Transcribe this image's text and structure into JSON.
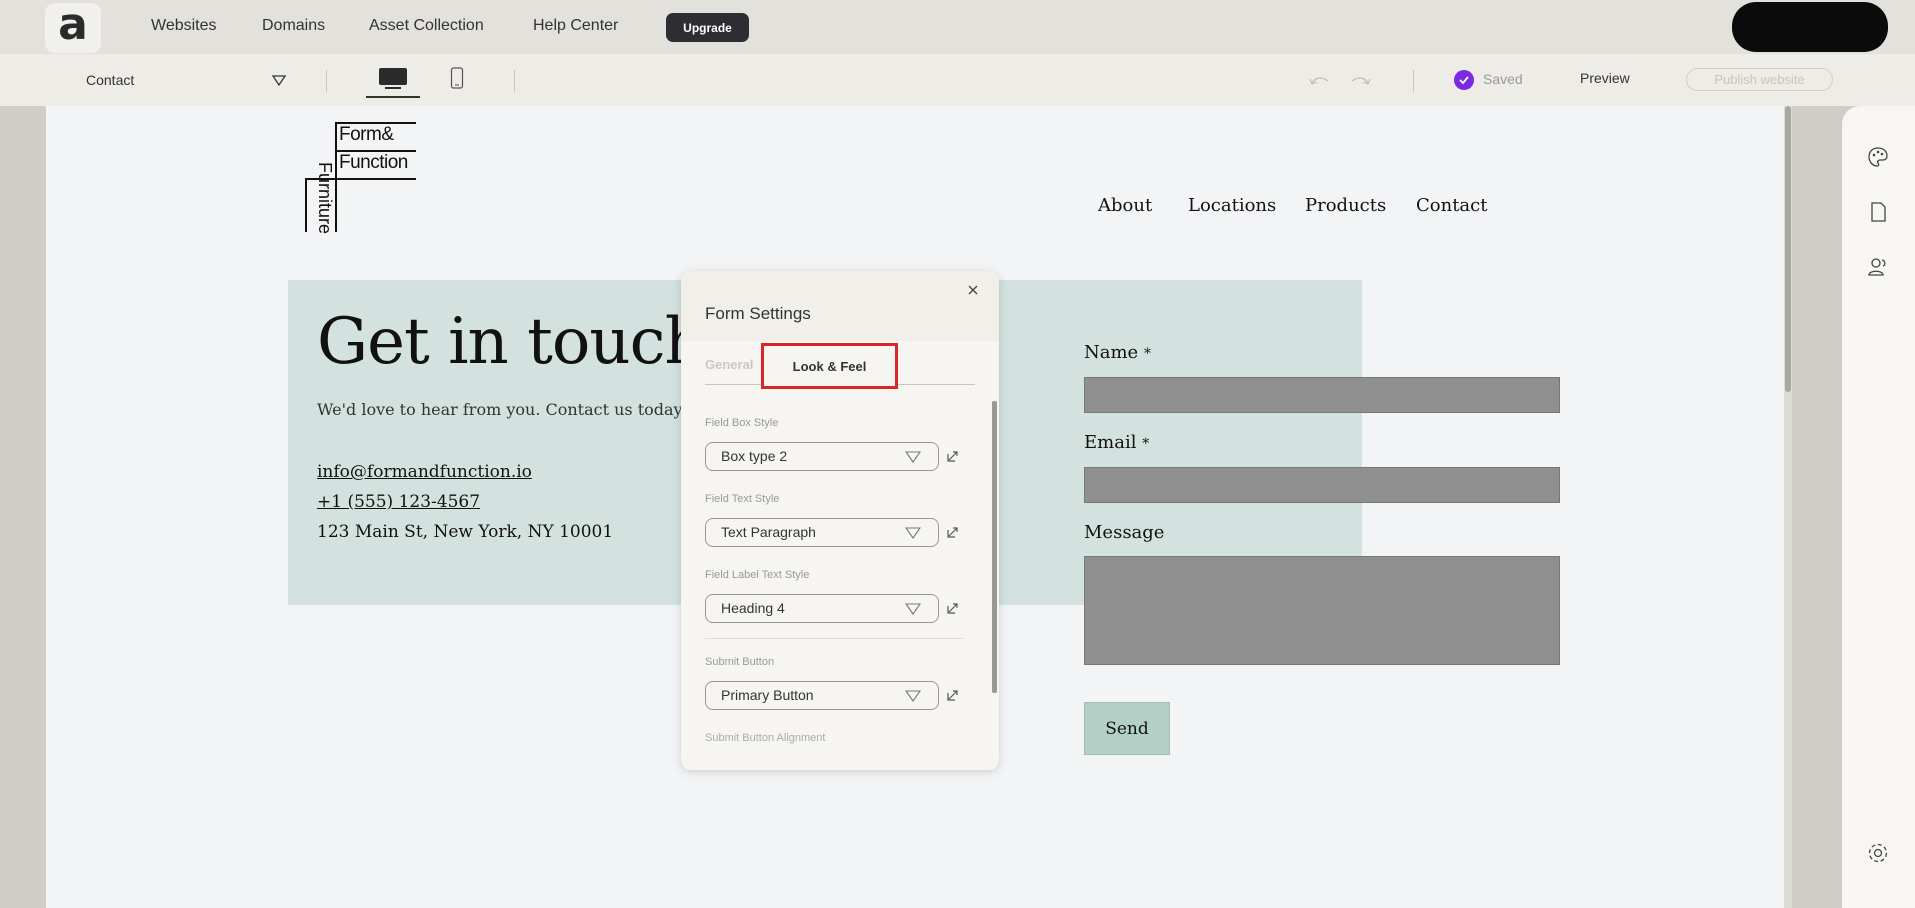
{
  "topnav": {
    "logo_glyph": "a",
    "links": [
      "Websites",
      "Domains",
      "Asset Collection",
      "Help Center"
    ],
    "upgrade_label": "Upgrade"
  },
  "toolbar": {
    "page_name": "Contact",
    "saved_label": "Saved",
    "preview_label": "Preview",
    "publish_label": "Publish website"
  },
  "site": {
    "brand": {
      "line1": "Form&",
      "line2": "Function",
      "vertical": "Furniture"
    },
    "nav": [
      "About",
      "Locations",
      "Products",
      "Contact"
    ],
    "hero": {
      "title": "Get in touch",
      "subtitle": "We'd love to hear from you. Contact us today!",
      "email": "info@formandfunction.io",
      "phone": "+1 (555) 123-4567",
      "address": "123 Main St, New York, NY 10001"
    },
    "form": {
      "name_label": "Name",
      "email_label": "Email",
      "required_mark": "*",
      "message_label": "Message",
      "send_label": "Send"
    }
  },
  "form_settings": {
    "title": "Form Settings",
    "tabs": {
      "general": "General",
      "look_feel": "Look & Feel"
    },
    "field_box_style": {
      "label": "Field Box Style",
      "value": "Box type 2"
    },
    "field_text_style": {
      "label": "Field Text Style",
      "value": "Text Paragraph"
    },
    "field_label_text_style": {
      "label": "Field Label Text Style",
      "value": "Heading 4"
    },
    "submit_button": {
      "label": "Submit Button",
      "value": "Primary Button"
    },
    "submit_alignment_label": "Submit Button Alignment"
  },
  "colors": {
    "hero_bg": "#d3e2de",
    "send_bg": "#b3d0c6",
    "field_bg": "#8f8f8f",
    "saved_check": "#7a2be2",
    "highlight": "#d9262b"
  }
}
